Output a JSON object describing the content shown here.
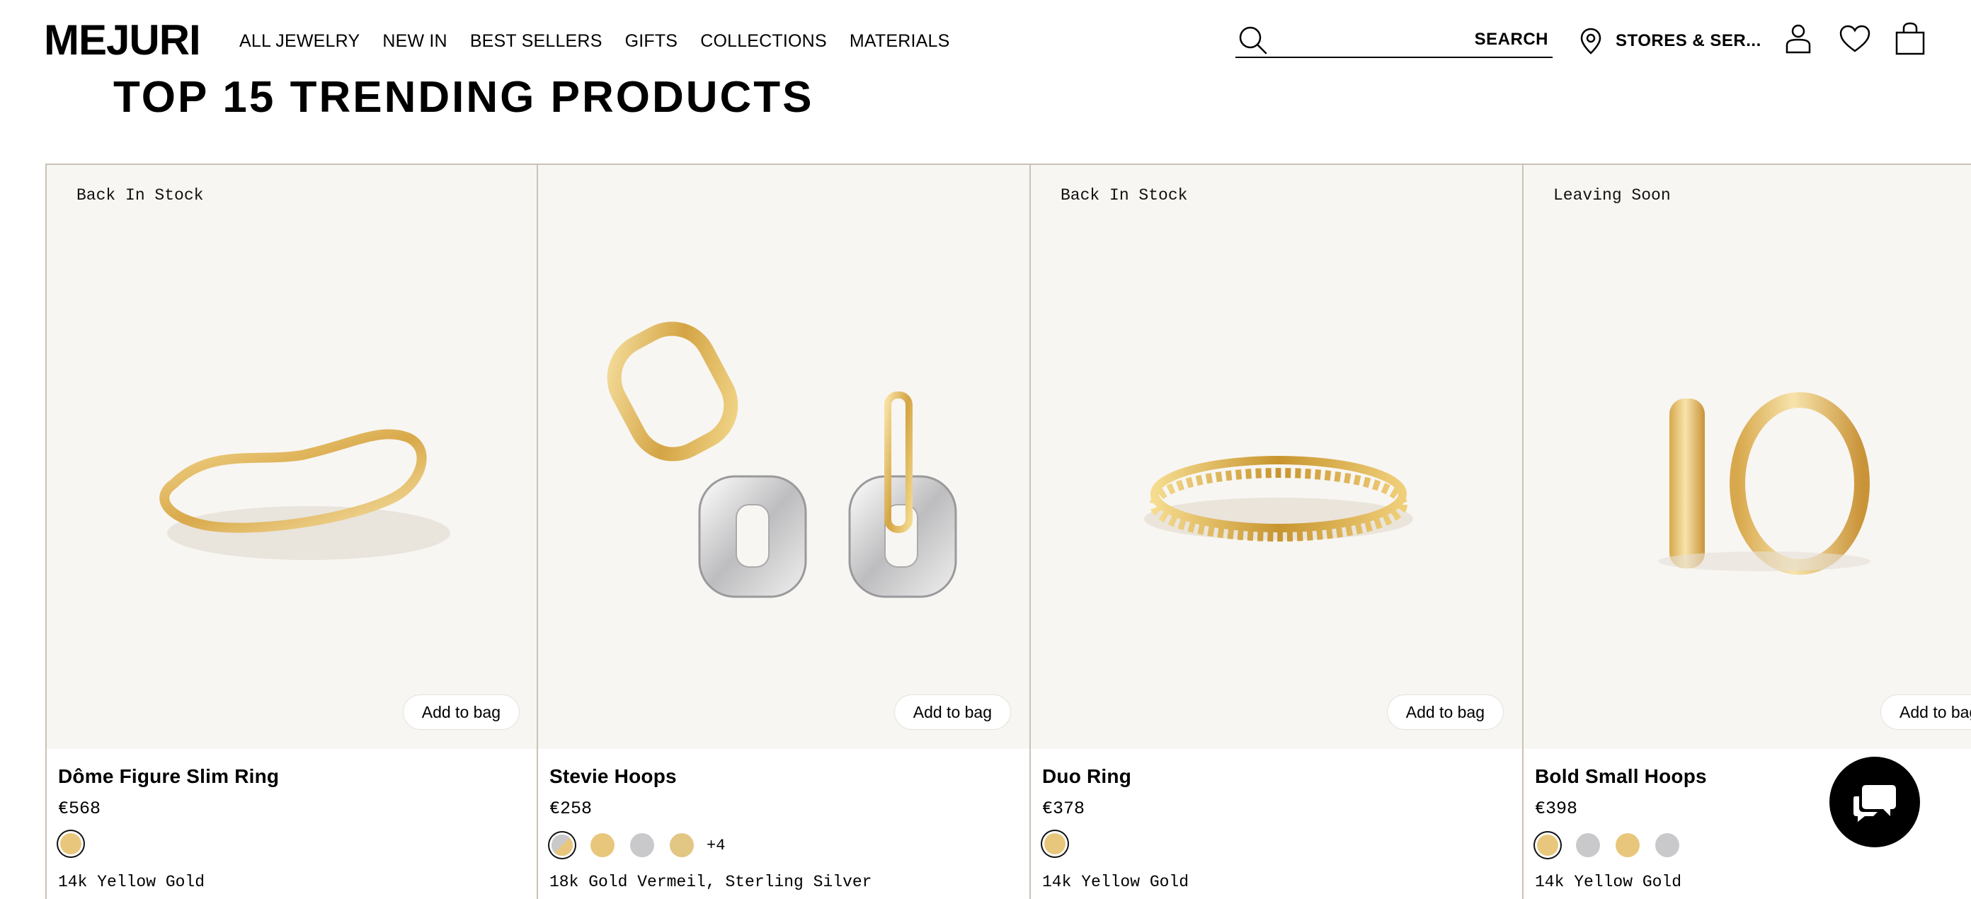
{
  "header": {
    "logo": "MEJURI",
    "nav": [
      "ALL JEWELRY",
      "NEW IN",
      "BEST SELLERS",
      "GIFTS",
      "COLLECTIONS",
      "MATERIALS"
    ],
    "search": {
      "placeholder": "",
      "label": "SEARCH"
    },
    "stores_label": "STORES & SER...",
    "icons": [
      "account-icon",
      "wishlist-icon",
      "bag-icon"
    ]
  },
  "page": {
    "title": "TOP 15 TRENDING PRODUCTS"
  },
  "colors": {
    "card_bg": "#f8f6f2",
    "gold": "#e8c77d",
    "silver": "#c9c9cb",
    "border": "#c9c2b6"
  },
  "products": [
    {
      "badge": "Back In Stock",
      "add_label": "Add to bag",
      "name": "Dôme Figure Slim Ring",
      "price": "€568",
      "swatches": [
        "gold"
      ],
      "more": "",
      "material": "14k Yellow Gold"
    },
    {
      "badge": "",
      "add_label": "Add to bag",
      "name": "Stevie Hoops",
      "price": "€258",
      "swatches": [
        "gold-silver",
        "gold",
        "silver",
        "gold"
      ],
      "more": "+4",
      "material": "18k Gold Vermeil, Sterling Silver"
    },
    {
      "badge": "Back In Stock",
      "add_label": "Add to bag",
      "name": "Duo Ring",
      "price": "€378",
      "swatches": [
        "gold"
      ],
      "more": "",
      "material": "14k Yellow Gold"
    },
    {
      "badge": "Leaving Soon",
      "add_label": "Add to bag",
      "name": "Bold Small Hoops",
      "price": "€398",
      "swatches": [
        "gold",
        "silver",
        "gold",
        "silver"
      ],
      "more": "",
      "material": "14k Yellow Gold"
    }
  ],
  "chat": {
    "icon": "chat-icon"
  }
}
